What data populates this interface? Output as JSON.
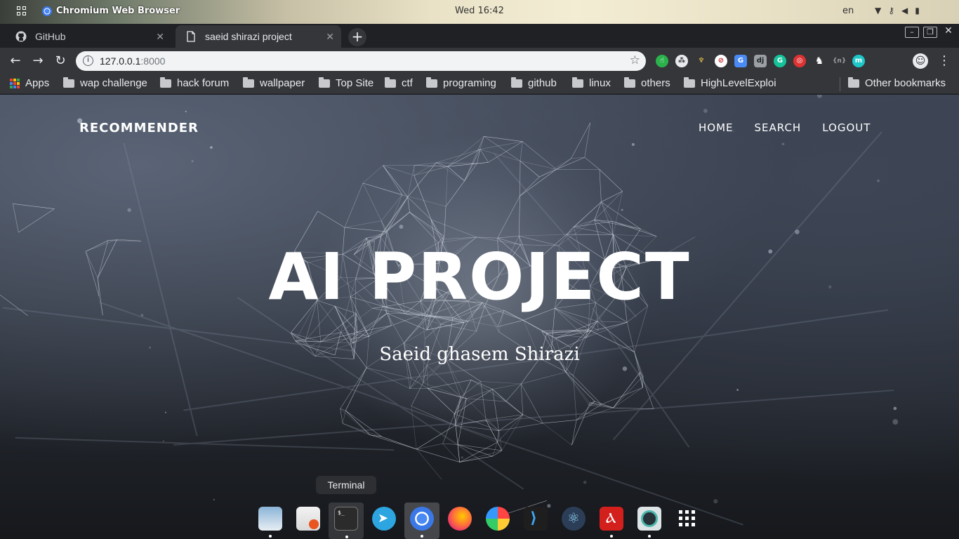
{
  "system_bar": {
    "app_title": "Chromium Web Browser",
    "clock": "Wed 16:42",
    "language": "en"
  },
  "tabs": [
    {
      "label": "GitHub",
      "icon": "github-icon"
    },
    {
      "label": "saeid shirazi project",
      "icon": "page-icon"
    }
  ],
  "toolbar": {
    "url_host": "127.0.0.1",
    "url_port": ":8000",
    "extensions": [
      "touch-icon",
      "extension-icon",
      "python-icon",
      "block-icon",
      "translate-icon",
      "dj-icon",
      "grammarly-icon",
      "target-icon",
      "gnu-icon",
      "json-icon",
      "mercury-icon"
    ]
  },
  "bookmarks": [
    {
      "label": "Apps",
      "type": "apps"
    },
    {
      "label": "wap challenge",
      "type": "folder"
    },
    {
      "label": "hack forum",
      "type": "folder"
    },
    {
      "label": "wallpaper",
      "type": "folder"
    },
    {
      "label": "Top Site",
      "type": "folder"
    },
    {
      "label": "ctf",
      "type": "folder"
    },
    {
      "label": "programing",
      "type": "folder"
    },
    {
      "label": "github",
      "type": "folder"
    },
    {
      "label": "linux",
      "type": "folder"
    },
    {
      "label": "others",
      "type": "folder"
    },
    {
      "label": "HighLevelExploi",
      "type": "folder"
    },
    {
      "label": "Other bookmarks",
      "type": "folder"
    }
  ],
  "page": {
    "brand": "RECOMMENDER",
    "nav": [
      "HOME",
      "SEARCH",
      "LOGOUT"
    ],
    "hero_title": "AI PROJECT",
    "hero_subtitle": "Saeid ghasem Shirazi"
  },
  "dock": {
    "tooltip": "Terminal",
    "apps": [
      "files-icon",
      "software-center-icon",
      "terminal-icon",
      "telegram-icon",
      "chromium-icon",
      "firefox-icon",
      "paint-icon",
      "vscode-icon",
      "atom-icon",
      "pdf-reader-icon",
      "camera-icon",
      "show-apps-icon"
    ]
  }
}
